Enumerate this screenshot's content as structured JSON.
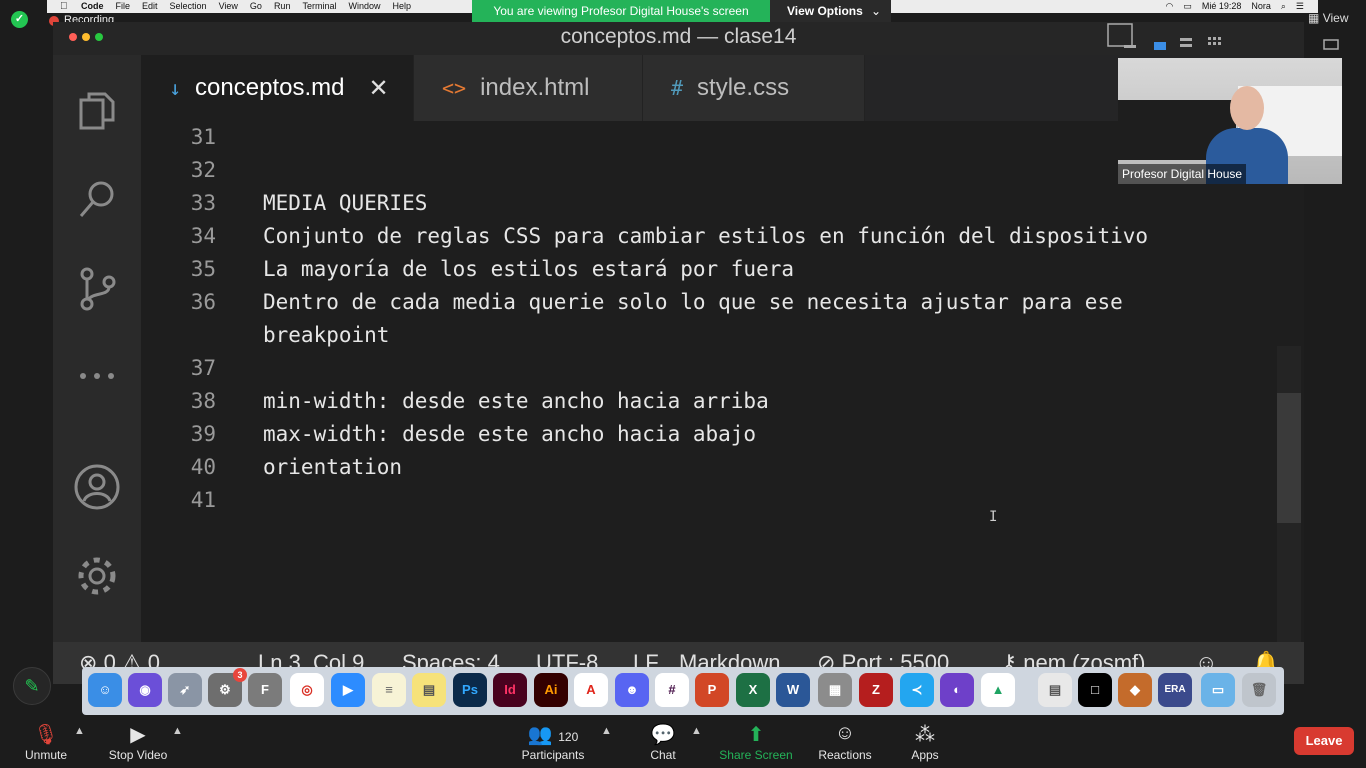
{
  "menubar": {
    "app": "Code",
    "menus": [
      "File",
      "Edit",
      "Selection",
      "View",
      "Go",
      "Run",
      "Terminal",
      "Window",
      "Help"
    ],
    "clock": "Mié 19:28",
    "user": "Nora"
  },
  "recording": "Recording",
  "share_banner": "You are viewing Profesor Digital House's screen",
  "view_options": "View Options",
  "view_button": "View",
  "window_title": "conceptos.md — clase14",
  "tabs": [
    {
      "icon": "↓",
      "label": "conceptos.md",
      "close": "✕"
    },
    {
      "icon": "<>",
      "label": "index.html"
    },
    {
      "icon": "#",
      "label": "style.css"
    }
  ],
  "editor": {
    "lines": [
      {
        "n": "31",
        "text": ""
      },
      {
        "n": "32",
        "text": ""
      },
      {
        "n": "33",
        "text": "MEDIA QUERIES"
      },
      {
        "n": "34",
        "text": "Conjunto de reglas CSS para cambiar estilos en función del dispositivo"
      },
      {
        "n": "35",
        "text": "La mayoría de los estilos estará por fuera"
      },
      {
        "n": "36",
        "text": "Dentro de cada media querie solo lo que se necesita ajustar para ese"
      },
      {
        "n": "",
        "text": "breakpoint"
      },
      {
        "n": "37",
        "text": ""
      },
      {
        "n": "38",
        "text": "min-width: desde este ancho hacia arriba"
      },
      {
        "n": "39",
        "text": "max-width: desde este ancho hacia abajo"
      },
      {
        "n": "40",
        "text": "orientation"
      },
      {
        "n": "41",
        "text": ""
      }
    ]
  },
  "statusbar": {
    "errors": "0",
    "warnings": "0",
    "position": "Ln 3, Col 9",
    "spaces": "Spaces: 4",
    "encoding": "UTF-8",
    "eol": "LF",
    "language": "Markdown",
    "port": "Port : 5500",
    "account": "nem (zosmf)"
  },
  "webcam": {
    "name": "Profesor Digital House"
  },
  "dock": {
    "badge": "3"
  },
  "zoombar": {
    "unmute": "Unmute",
    "stop_video": "Stop Video",
    "participants": "Participants",
    "participants_count": "120",
    "chat": "Chat",
    "share_screen": "Share Screen",
    "reactions": "Reactions",
    "apps": "Apps",
    "leave": "Leave"
  },
  "colors": {
    "accent_green": "#24b359",
    "leave_red": "#d83a30",
    "vscode_bg": "#1e1e1e"
  }
}
